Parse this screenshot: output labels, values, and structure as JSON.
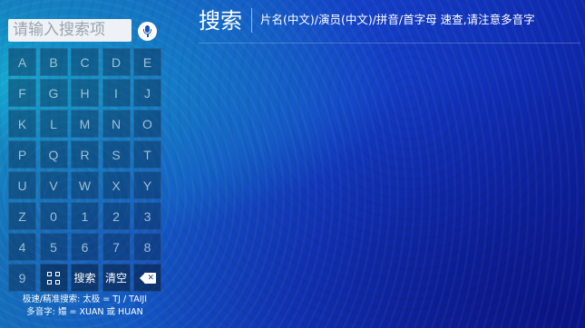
{
  "search": {
    "placeholder": "请输入搜索项"
  },
  "keyboard": {
    "letter_keys": [
      "A",
      "B",
      "C",
      "D",
      "E",
      "F",
      "G",
      "H",
      "I",
      "J",
      "K",
      "L",
      "M",
      "N",
      "O",
      "P",
      "Q",
      "R",
      "S",
      "T",
      "U",
      "V",
      "W",
      "X",
      "Y",
      "Z",
      "0",
      "1",
      "2",
      "3",
      "4",
      "5",
      "6",
      "7",
      "8",
      "9"
    ],
    "search_label": "搜索",
    "clear_label": "清空"
  },
  "hints": {
    "line1": "极速/精准搜索: 太极 = TJ / TAIJI",
    "line2": "多音字: 嬛 = XUAN 或 HUAN"
  },
  "header": {
    "title": "搜索",
    "hint": "片名(中文)/演员(中文)/拼音/首字母 速查,请注意多音字"
  },
  "icons": {
    "mic": "microphone-icon",
    "grid": "grid-icon",
    "backspace": "backspace-icon"
  },
  "colors": {
    "background_primary": "#1440c8",
    "background_accent": "#14a0d0",
    "text": "#ffffff"
  }
}
